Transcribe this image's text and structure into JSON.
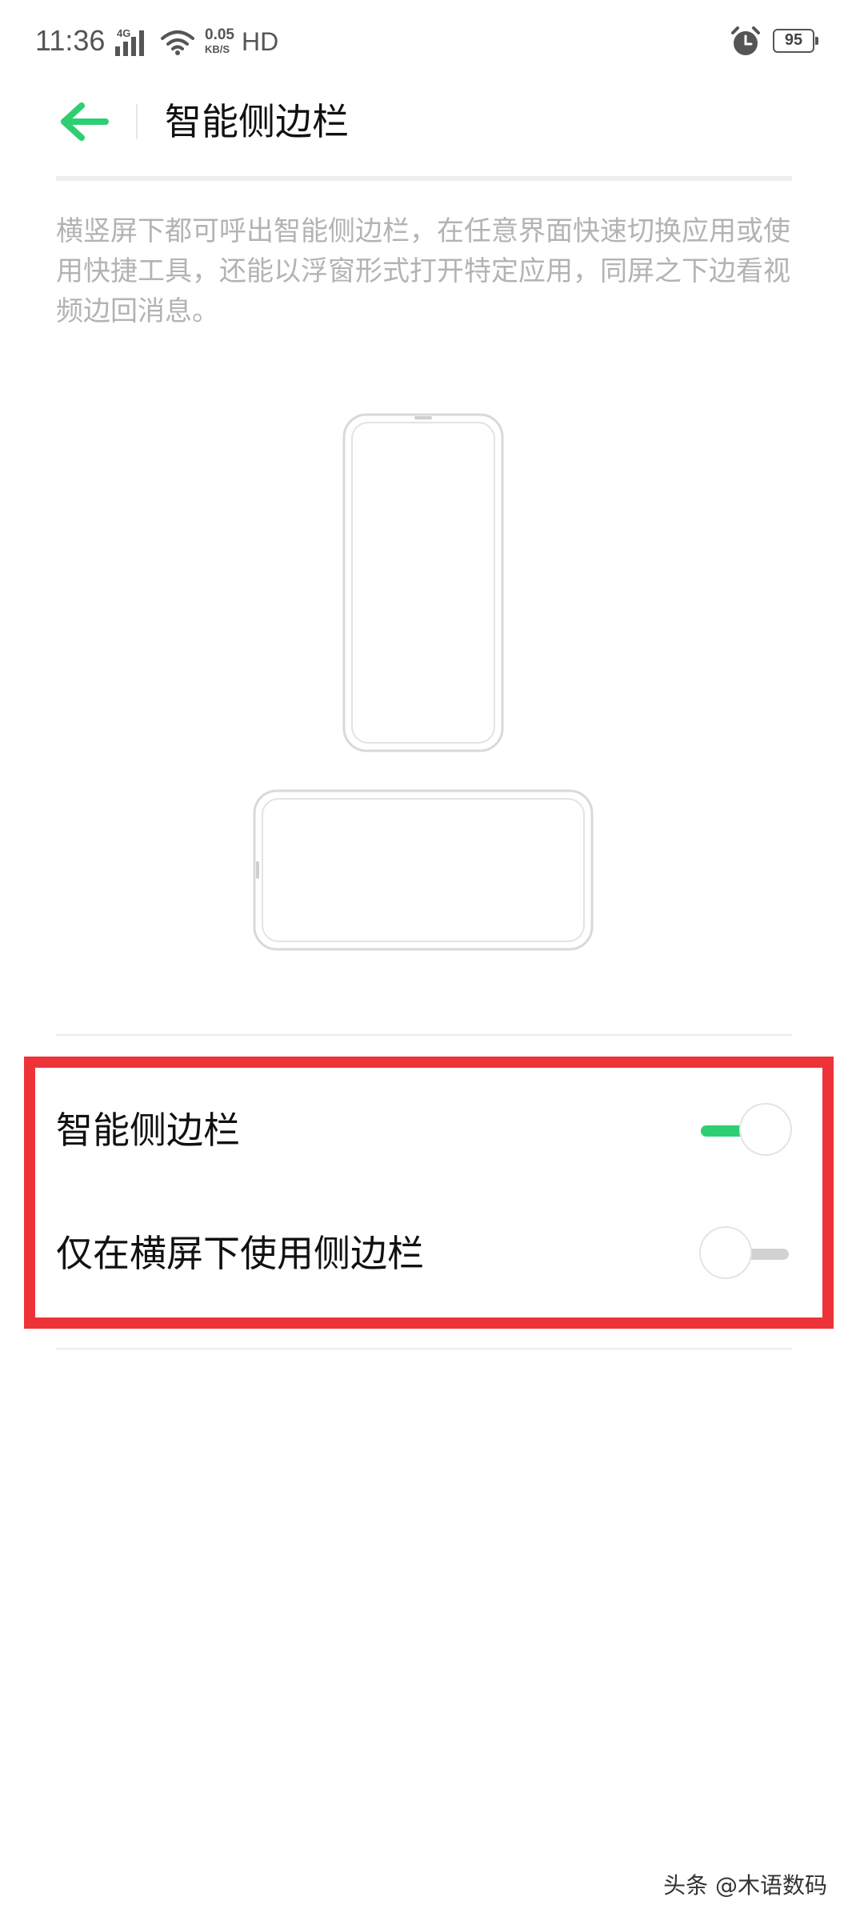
{
  "status_bar": {
    "time": "11:36",
    "network": "4G",
    "speed_value": "0.05",
    "speed_unit": "KB/S",
    "hd": "HD",
    "battery": "95",
    "icons": [
      "signal-icon",
      "wifi-icon",
      "alarm-clock-icon",
      "battery-icon"
    ]
  },
  "header": {
    "title": "智能侧边栏",
    "back_icon": "arrow-left-icon",
    "accent_color": "#2ecf73"
  },
  "description": "横竖屏下都可呼出智能侧边栏，在任意界面快速切换应用或使用快捷工具，还能以浮窗形式打开特定应用，同屏之下边看视频边回消息。",
  "illustration": {
    "items": [
      "phone-portrait-icon",
      "phone-landscape-icon"
    ]
  },
  "settings": [
    {
      "label": "智能侧边栏",
      "enabled": true
    },
    {
      "label": "仅在横屏下使用侧边栏",
      "enabled": false
    }
  ],
  "highlight_color": "#ee3338",
  "watermark": "头条 @木语数码"
}
